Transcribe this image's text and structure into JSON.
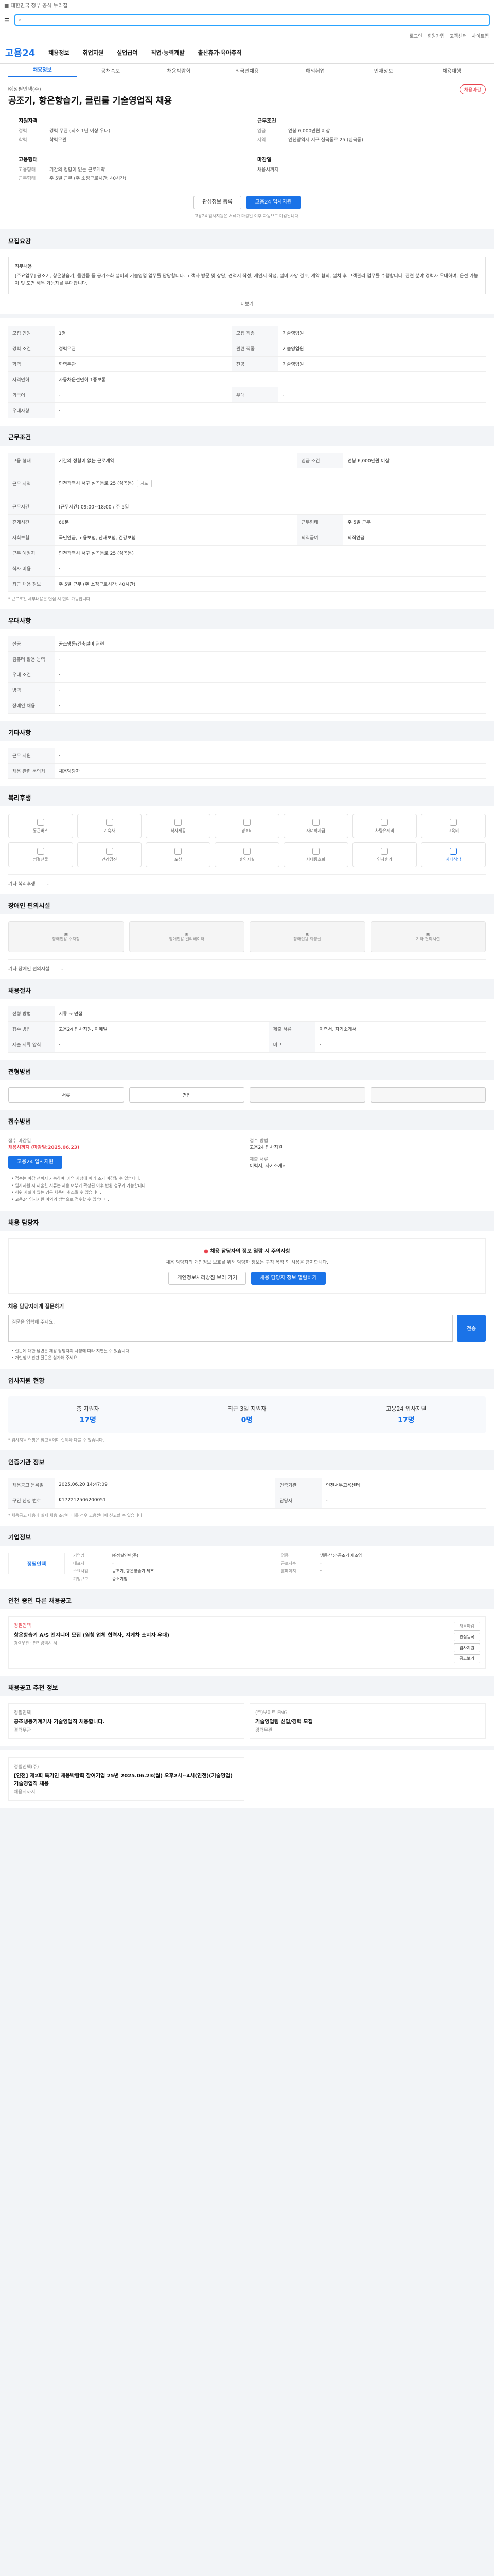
{
  "header": {
    "top_links": [
      "로그인",
      "회원가입",
      "고객센터",
      "사이트맵"
    ],
    "search_placeholder": "",
    "logo": "고용24",
    "gnb": [
      "채용정보",
      "취업지원",
      "실업급여",
      "직업·능력개발",
      "출산휴가·육아휴직"
    ],
    "subtabs": [
      "채용정보",
      "공채속보",
      "채용박람회",
      "외국인채용",
      "해외취업",
      "인재정보",
      "채용대행"
    ]
  },
  "job": {
    "company": "㈜정필인텍(주)",
    "title": "공조기, 항온항습기, 클린룸 기술영업직 채용",
    "status": "채용마감",
    "qual_head": "지원자격",
    "qual": [
      {
        "k": "경력",
        "v": "경력 무관 (최소 1년 이상 우대)"
      },
      {
        "k": "학력",
        "v": "학력무관"
      }
    ],
    "cond_head": "근무조건",
    "cond": [
      {
        "k": "임금",
        "v": "연봉 6,000만원 이상"
      },
      {
        "k": "지역",
        "v": "인천광역시 서구 심곡동로 25 (심곡동)"
      }
    ],
    "form_head": "고용형태",
    "form": [
      {
        "k": "고용형태",
        "v": "기간의 정함이 없는 근로계약"
      },
      {
        "k": "근무형태",
        "v": "주 5일 근무 (주 소정근로시간: 40시간)"
      }
    ],
    "apply_head": "마감일",
    "apply": [
      {
        "k": "",
        "v": "채용시까지"
      }
    ],
    "btn_interest": "관심정보 등록",
    "btn_apply": "고용24 입사지원",
    "notice": "고용24 입사지원은 서류가 마감일 이후 자동으로 마감됩니다."
  },
  "detail": {
    "title": "모집요강",
    "box_head": "직무내용",
    "box_text": "[주요업무] 공조기, 항온항습기, 클린룸 등 공기조화 설비의 기술영업 업무를 담당합니다. 고객사 방문 및 상담, 견적서 작성, 제안서 작성, 설비 사양 검토, 계약 협의, 설치 후 고객관리 업무를 수행합니다. 관련 분야 경력자 우대하며, 운전 가능자 및 도면 해독 가능자를 우대합니다.",
    "more": "더보기",
    "rows": [
      {
        "k": "모집 인원",
        "v": "1명",
        "k2": "모집 직종",
        "v2": "기술영업원"
      },
      {
        "k": "경력 조건",
        "v": "경력무관",
        "k2": "관련 직종",
        "v2": "기술영업원"
      },
      {
        "k": "학력",
        "v": "학력무관",
        "k2": "전공",
        "v2": "기술영업원"
      },
      {
        "k": "자격면허",
        "v": "자동차운전면허 1종보통",
        "k2": "",
        "v2": ""
      },
      {
        "k": "외국어",
        "v": "-",
        "k2": "우대",
        "v2": "-"
      },
      {
        "k": "우대사항",
        "v": "-",
        "k2": "",
        "v2": ""
      }
    ]
  },
  "work": {
    "title": "근무조건",
    "rows": [
      {
        "k": "고용 형태",
        "v": "기간의 정함이 없는 근로계약",
        "k2": "임금 조건",
        "v2": "연봉 6,000만원 이상"
      },
      {
        "k": "근무 지역",
        "v": "인천광역시 서구 심곡동로 25 (심곡동)",
        "k2": "",
        "v2": ""
      },
      {
        "k": "근무시간",
        "v": "(근무시간) 09:00~18:00 / 주 5일",
        "k2": "",
        "v2": ""
      },
      {
        "k": "휴게시간",
        "v": "60분",
        "k2": "근무형태",
        "v2": "주 5일 근무"
      },
      {
        "k": "사회보험",
        "v": "국민연금, 고용보험, 산재보험, 건강보험",
        "k2": "퇴직급여",
        "v2": "퇴직연금"
      },
      {
        "k": "근무 예정지",
        "v": "인천광역시 서구 심곡동로 25 (심곡동)",
        "k2": "",
        "v2": ""
      },
      {
        "k": "식사 비용",
        "v": "-",
        "k2": "",
        "v2": ""
      },
      {
        "k": "최근 채용 정보",
        "v": "주 5일 근무 (주 소정근로시간: 40시간)",
        "k2": "",
        "v2": ""
      }
    ],
    "note": "* 근로조건 세부내용은 면접 시 협의 가능합니다."
  },
  "prefer": {
    "title": "우대사항",
    "rows": [
      {
        "k": "전공",
        "v": "공조냉동/건축설비 관련"
      },
      {
        "k": "컴퓨터 활용 능력",
        "v": "-"
      },
      {
        "k": "우대 조건",
        "v": "-"
      },
      {
        "k": "병역",
        "v": "-"
      },
      {
        "k": "장애인 채용",
        "v": "-"
      }
    ]
  },
  "etc": {
    "title": "기타사항",
    "rows": [
      {
        "k": "근무 지원",
        "v": "-"
      },
      {
        "k": "채용 관련 문의처",
        "v": "채용담당자"
      }
    ]
  },
  "welfare": {
    "title": "복리후생",
    "icons": [
      "통근버스",
      "기숙사",
      "식사제공",
      "경조비",
      "자녀학자금",
      "차량유지비",
      "교육비",
      "명절선물",
      "건강검진",
      "포상",
      "휴양시설",
      "사내동호회",
      "연차휴가",
      "사내식당"
    ],
    "others_label": "기타 복리후생",
    "others": "-"
  },
  "support": {
    "title": "장애인 편의시설",
    "icons": [
      "장애인용 주차장",
      "장애인용 엘리베이터",
      "장애인용 화장실",
      "기타 편의시설"
    ],
    "others_label": "기타 장애인 편의시설",
    "others": "-"
  },
  "hiring": {
    "title": "채용절차",
    "rows": [
      {
        "k": "전형 방법",
        "v": "서류 → 면접",
        "k2": "",
        "v2": ""
      },
      {
        "k": "접수 방법",
        "v": "고용24 입사지원, 이메일",
        "k2": "제출 서류",
        "v2": "이력서, 자기소개서"
      },
      {
        "k": "제출 서류 양식",
        "v": "-",
        "k2": "비고",
        "v2": "-"
      }
    ]
  },
  "steps": {
    "title": "전형방법",
    "items": [
      "서류",
      "면접",
      "",
      ""
    ]
  },
  "method": {
    "title": "접수방법",
    "deadline_label": "접수 마감일",
    "deadline": "채용시까지 (마감일:2025.06.23)",
    "method_label": "접수 방법",
    "method": "고용24 입사지원",
    "doc_label": "제출 서류",
    "doc": "이력서, 자기소개서",
    "apply_btn": "고용24 입사지원",
    "bullets": [
      "• 접수는 마감 전까지 가능하며, 기업 사정에 따라 조기 마감될 수 있습니다.",
      "• 입사지원 시 제출한 서류는 채용 여부가 확정된 이후 반환 청구가 가능합니다.",
      "• 허위 사실이 있는 경우 채용이 취소될 수 있습니다.",
      "• 고용24 입사지원 이외의 방법으로 접수할 수 있습니다."
    ]
  },
  "manager": {
    "title": "채용 담당자",
    "warn": "채용 담당자의 정보 열람 시 주의사항",
    "text": "채용 담당자의 개인정보 보호를 위해 담당자 정보는 구직 목적 외 사용을 금지합니다.",
    "btn1": "개인정보처리방침 보러 가기",
    "btn2": "채용 담당자 정보 열람하기"
  },
  "qa": {
    "title": "채용 담당자에게 질문하기",
    "placeholder": "질문을 입력해 주세요.",
    "btn": "전송",
    "hints": [
      "• 질문에 대한 답변은 채용 담당자의 사정에 따라 지연될 수 있습니다.",
      "• 개인정보 관련 질문은 삼가해 주세요."
    ]
  },
  "stats": {
    "title": "입사지원 현황",
    "items": [
      {
        "k": "총 지원자",
        "v": "17명"
      },
      {
        "k": "최근 3일 지원자",
        "v": "0명"
      },
      {
        "k": "고용24 입사지원",
        "v": "17명"
      }
    ],
    "note": "* 입사지원 현황은 참고용이며 실제와 다를 수 있습니다."
  },
  "reg": {
    "title": "인증기관 정보",
    "rows": [
      {
        "k": "채용공고 등록일",
        "v": "2025.06.20 14:47:09",
        "k2": "인증기관",
        "v2": "인천서부고용센터"
      },
      {
        "k": "구인 신청 번호",
        "v": "K172212506200051",
        "k2": "담당자",
        "v2": "-"
      }
    ],
    "note": "* 채용공고 내용과 실제 채용 조건이 다를 경우 고용센터에 신고할 수 있습니다."
  },
  "corp": {
    "title": "기업정보",
    "logo": "정필인텍",
    "name": "㈜정필인텍(주)",
    "rows": [
      {
        "k": "기업명",
        "v": "㈜정필인텍(주)",
        "k2": "업종",
        "v2": "냉동·냉장·공조기 제조업"
      },
      {
        "k": "대표자",
        "v": "-",
        "k2": "근로자수",
        "v2": "-"
      },
      {
        "k": "주요사업",
        "v": "공조기, 항온항습기 제조",
        "k2": "홈페이지",
        "v2": "-"
      },
      {
        "k": "기업규모",
        "v": "중소기업",
        "k2": "",
        "v2": ""
      }
    ]
  },
  "related": {
    "title": "인천 중인 다른 채용공고",
    "tag": "채용마감",
    "company": "정필인텍",
    "job": "항온항습기 A/S 엔지니어 모집 (원청 업체 협력사, 지게차 소지자 우대)",
    "info": "경력무관 · 인천광역시 서구",
    "side": [
      "관심등록",
      "입사지원",
      "공고보기"
    ]
  },
  "similar": {
    "title": "채용공고 추천 정보",
    "items": [
      {
        "co": "정필인텍",
        "job": "공조냉동기계기사 기술영업직 채용합니다.",
        "info": "경력무관"
      },
      {
        "co": "(주)보이트 ENG",
        "job": "기술영업팀 신입/경력 모집",
        "info": "경력무관"
      }
    ]
  },
  "popular": {
    "title": "정필인텍(주)",
    "job": "[인천] 제2회 특기인 채용박람회 참여기업 25년 2025.06.23(월) 오후2시~4시(인천)(기술영업) 기술영업직 채용",
    "info": "채용시까지"
  }
}
